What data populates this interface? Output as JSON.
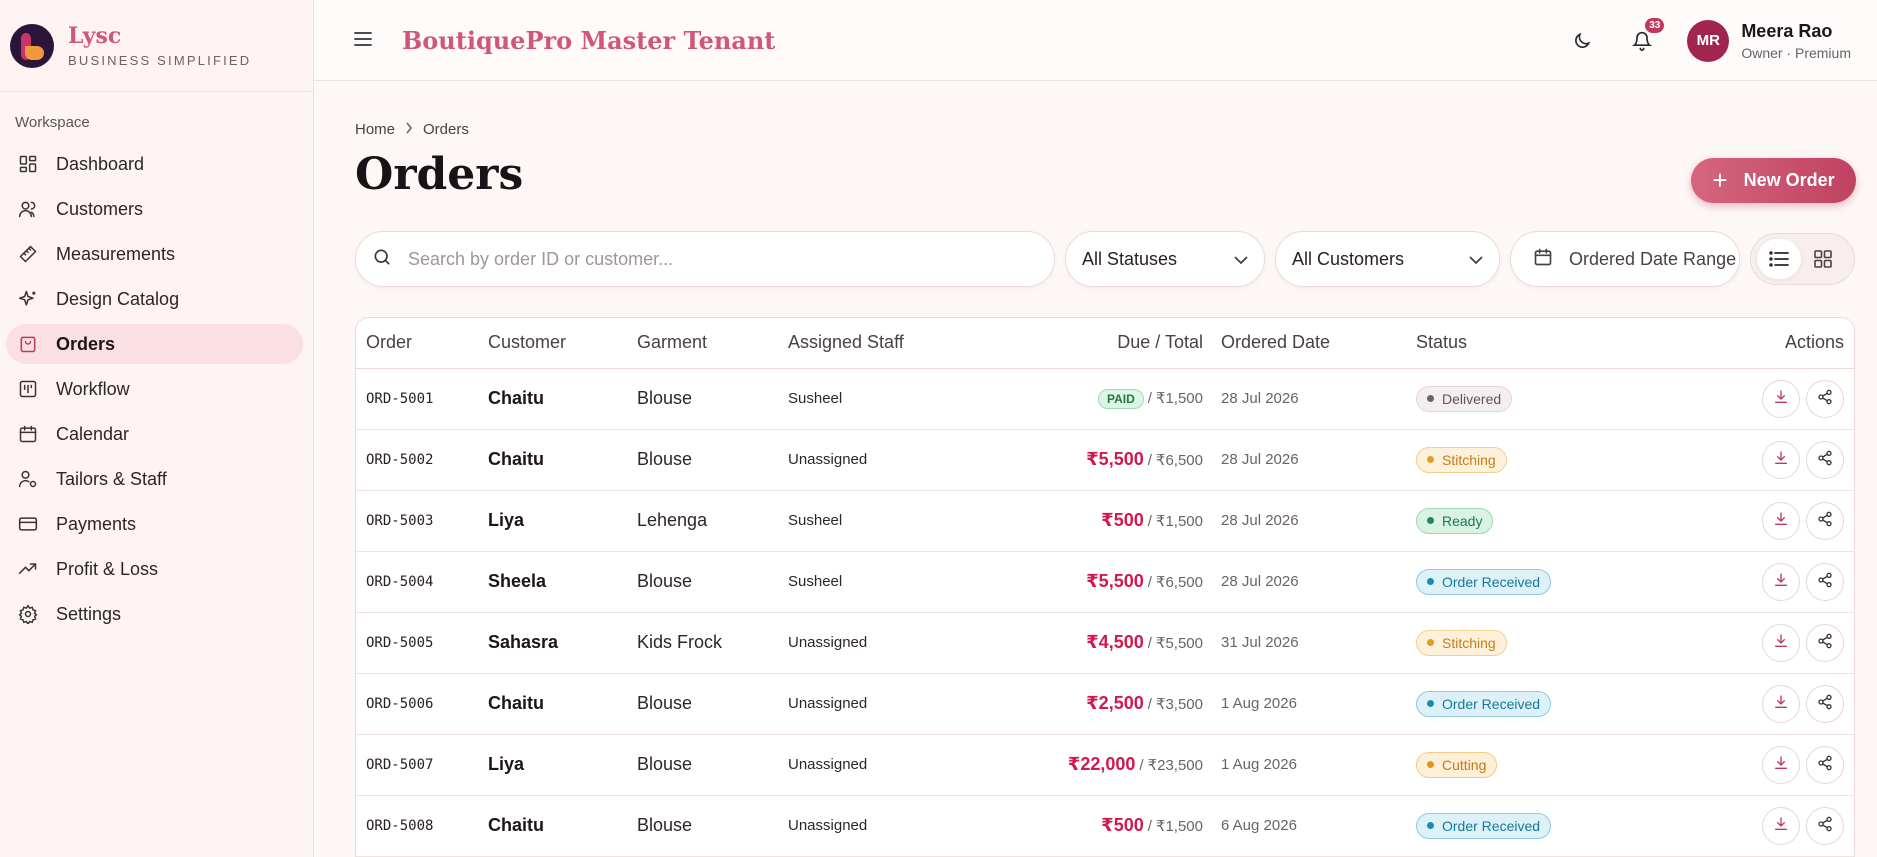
{
  "brand": {
    "name": "Lysc",
    "tagline": "BUSINESS SIMPLIFIED"
  },
  "sidebar": {
    "section": "Workspace",
    "items": [
      {
        "label": "Dashboard",
        "icon": "dashboard-icon",
        "active": false
      },
      {
        "label": "Customers",
        "icon": "users-icon",
        "active": false
      },
      {
        "label": "Measurements",
        "icon": "ruler-icon",
        "active": false
      },
      {
        "label": "Design Catalog",
        "icon": "sparkles-icon",
        "active": false
      },
      {
        "label": "Orders",
        "icon": "shopping-bag-icon",
        "active": true
      },
      {
        "label": "Workflow",
        "icon": "kanban-icon",
        "active": false
      },
      {
        "label": "Calendar",
        "icon": "calendar-icon",
        "active": false
      },
      {
        "label": "Tailors & Staff",
        "icon": "user-cog-icon",
        "active": false
      },
      {
        "label": "Payments",
        "icon": "credit-card-icon",
        "active": false
      },
      {
        "label": "Profit & Loss",
        "icon": "trending-up-icon",
        "active": false
      },
      {
        "label": "Settings",
        "icon": "gear-icon",
        "active": false
      }
    ]
  },
  "header": {
    "tenant": "BoutiquePro Master Tenant",
    "notifications": "33",
    "user": {
      "initials": "MR",
      "name": "Meera Rao",
      "role": "Owner · Premium"
    }
  },
  "main": {
    "breadcrumb": [
      "Home",
      "Orders"
    ],
    "title": "Orders",
    "new_order_label": "New Order",
    "search_placeholder": "Search by order ID or customer...",
    "status_filter": "All Statuses",
    "customer_filter": "All Customers",
    "date_range_label": "Ordered Date Range",
    "view_mode": "list"
  },
  "table": {
    "columns": [
      "Order",
      "Customer",
      "Garment",
      "Assigned Staff",
      "Due / Total",
      "Ordered Date",
      "Status",
      "Actions"
    ],
    "rows": [
      {
        "id": "ORD-5001",
        "customer": "Chaitu",
        "garment": "Blouse",
        "staff": "Susheel",
        "due": "PAID",
        "paid": true,
        "total": "₹1,500",
        "date": "28 Jul 2026",
        "status": "Delivered",
        "status_class": "st-delivered"
      },
      {
        "id": "ORD-5002",
        "customer": "Chaitu",
        "garment": "Blouse",
        "staff": "Unassigned",
        "due": "₹5,500",
        "paid": false,
        "total": "₹6,500",
        "date": "28 Jul 2026",
        "status": "Stitching",
        "status_class": "st-stitching"
      },
      {
        "id": "ORD-5003",
        "customer": "Liya",
        "garment": "Lehenga",
        "staff": "Susheel",
        "due": "₹500",
        "paid": false,
        "total": "₹1,500",
        "date": "28 Jul 2026",
        "status": "Ready",
        "status_class": "st-ready"
      },
      {
        "id": "ORD-5004",
        "customer": "Sheela",
        "garment": "Blouse",
        "staff": "Susheel",
        "due": "₹5,500",
        "paid": false,
        "total": "₹6,500",
        "date": "28 Jul 2026",
        "status": "Order Received",
        "status_class": "st-received"
      },
      {
        "id": "ORD-5005",
        "customer": "Sahasra",
        "garment": "Kids Frock",
        "staff": "Unassigned",
        "due": "₹4,500",
        "paid": false,
        "total": "₹5,500",
        "date": "31 Jul 2026",
        "status": "Stitching",
        "status_class": "st-stitching"
      },
      {
        "id": "ORD-5006",
        "customer": "Chaitu",
        "garment": "Blouse",
        "staff": "Unassigned",
        "due": "₹2,500",
        "paid": false,
        "total": "₹3,500",
        "date": "1 Aug 2026",
        "status": "Order Received",
        "status_class": "st-received"
      },
      {
        "id": "ORD-5007",
        "customer": "Liya",
        "garment": "Blouse",
        "staff": "Unassigned",
        "due": "₹22,000",
        "paid": false,
        "total": "₹23,500",
        "date": "1 Aug 2026",
        "status": "Cutting",
        "status_class": "st-cutting"
      },
      {
        "id": "ORD-5008",
        "customer": "Chaitu",
        "garment": "Blouse",
        "staff": "Unassigned",
        "due": "₹500",
        "paid": false,
        "total": "₹1,500",
        "date": "6 Aug 2026",
        "status": "Order Received",
        "status_class": "st-received"
      }
    ]
  },
  "colors": {
    "brand": "#d1577a",
    "accent": "#bf4261",
    "due": "#d1194f"
  }
}
